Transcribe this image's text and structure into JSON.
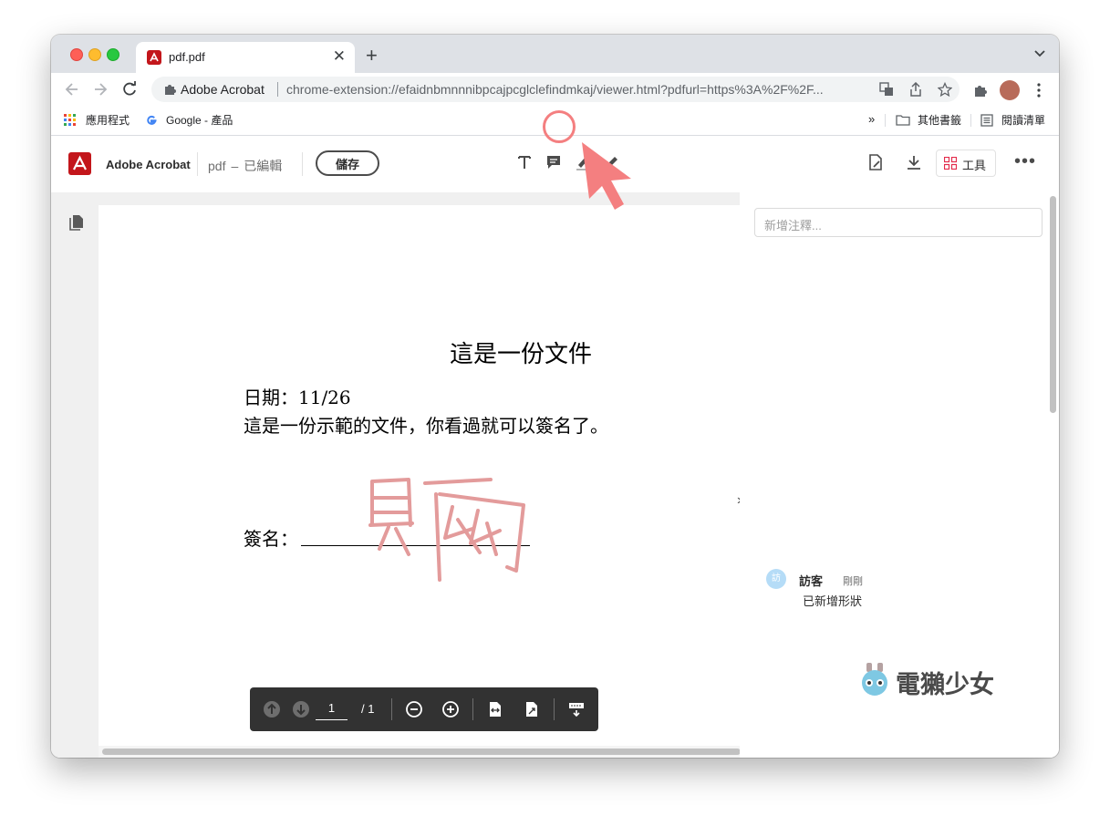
{
  "browser": {
    "tab_title": "pdf.pdf",
    "omnibox": {
      "site": "Adobe Acrobat",
      "url": "chrome-extension://efaidnbmnnnibpcajpcglclefindmkaj/viewer.html?pdfurl=https%3A%2F%2F..."
    },
    "bookmarks": {
      "apps": "應用程式",
      "google": "Google - 產品",
      "overflow": "»",
      "other": "其他書籤",
      "reading_list": "閱讀清單"
    }
  },
  "acrobat": {
    "app_name": "Adobe Acrobat",
    "doc_name": "pdf",
    "separator": "–",
    "status": "已編輯",
    "save_label": "儲存",
    "tools_label": "工具",
    "more": "•••"
  },
  "document": {
    "title": "這是一份文件",
    "date_line": "日期：11/26",
    "body_line": "這是一份示範的文件，你看過就可以簽名了。",
    "signature_label": "簽名："
  },
  "page_controls": {
    "current_page": "1",
    "total": "/ 1"
  },
  "comments": {
    "placeholder": "新增注釋...",
    "items": [
      {
        "avatar": "訪",
        "author": "訪客",
        "time": "剛剛",
        "text": "已新增形狀"
      }
    ]
  },
  "watermark": "電獺少女",
  "colors": {
    "acrobat_red": "#c3161b",
    "highlight_pink": "#f47f80",
    "signature_ink": "#e39b9b"
  }
}
